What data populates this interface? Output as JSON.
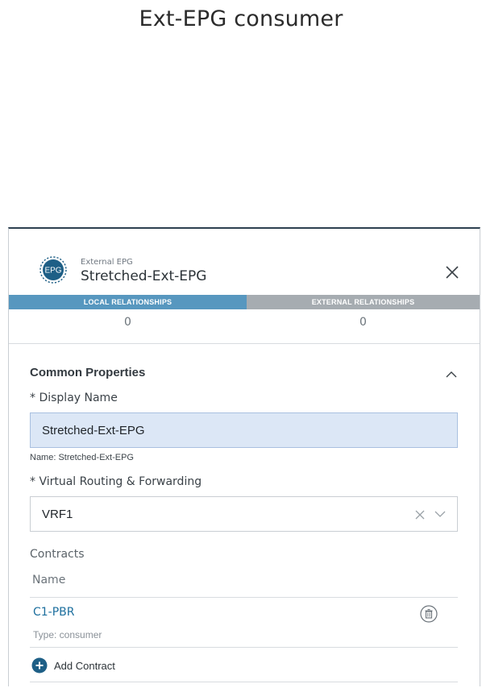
{
  "page": {
    "title": "Ext-EPG consumer"
  },
  "panel": {
    "header": {
      "badge_text": "EPG",
      "type_label": "External EPG",
      "object_name": "Stretched-Ext-EPG",
      "close_icon": "close-icon"
    },
    "tabs": [
      {
        "label": "LOCAL RELATIONSHIPS",
        "count": "0",
        "active": true
      },
      {
        "label": "EXTERNAL RELATIONSHIPS",
        "count": "0",
        "active": false
      }
    ],
    "common_properties": {
      "title": "Common Properties",
      "display_name": {
        "label": "* Display Name",
        "value": "Stretched-Ext-EPG",
        "hint": "Name: Stretched-Ext-EPG"
      },
      "vrf": {
        "label": "* Virtual Routing & Forwarding",
        "value": "VRF1"
      },
      "contracts": {
        "label": "Contracts",
        "column_header": "Name",
        "items": [
          {
            "name": "C1-PBR",
            "type": "Type: consumer"
          }
        ],
        "add_label": "Add Contract"
      }
    },
    "colors": {
      "active_tab": "#5797bf",
      "inactive_tab": "#a6acb1",
      "link": "#1d6f9e",
      "badge": "#1e5f86",
      "input_highlight": "#dce7f6"
    }
  }
}
